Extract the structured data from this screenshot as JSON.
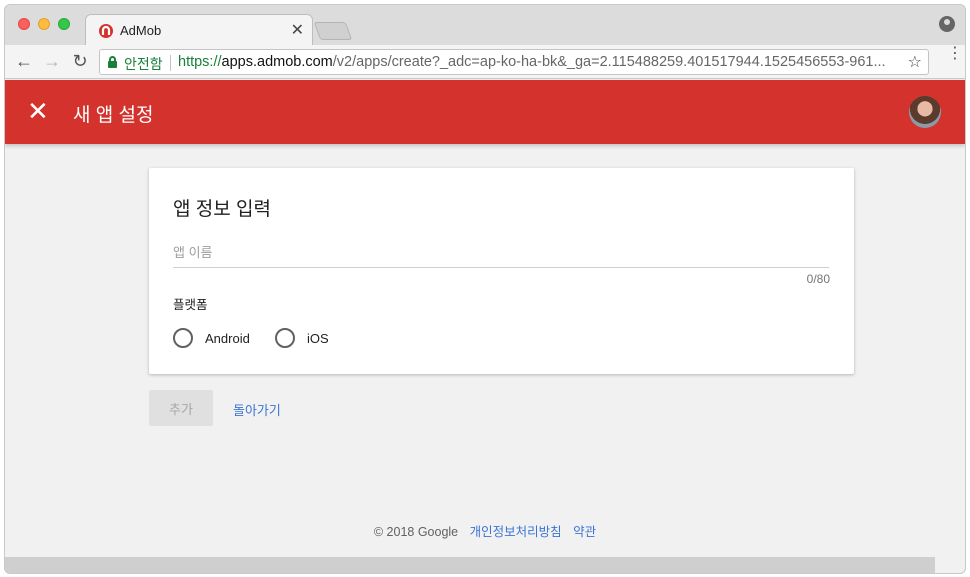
{
  "browser": {
    "tab": {
      "title": "AdMob",
      "close": "✕"
    },
    "secure_label": "안전함",
    "url": {
      "scheme": "https://",
      "host": "apps.admob.com",
      "path": "/v2/apps/create?_adc=ap-ko-ha-bk&_ga=2.115488259.401517944.1525456553-961..."
    },
    "star": "☆",
    "menu": "⋮",
    "nav": {
      "back": "←",
      "forward": "→",
      "reload": "↻"
    }
  },
  "appbar": {
    "close": "✕",
    "title": "새 앱 설정",
    "color": "#d4322c"
  },
  "card": {
    "title": "앱 정보 입력",
    "name_placeholder": "앱 이름",
    "name_value": "",
    "counter": "0/80",
    "platform_label": "플랫폼",
    "platforms": [
      {
        "label": "Android",
        "selected": false
      },
      {
        "label": "iOS",
        "selected": false
      }
    ]
  },
  "actions": {
    "add_label": "추가",
    "back_label": "돌아가기"
  },
  "footer": {
    "copyright": "© 2018 Google",
    "privacy": "개인정보처리방침",
    "terms": "약관"
  },
  "colors": {
    "accent_red": "#d4322c",
    "link_blue": "#3b74d6",
    "secure_green": "#188038"
  }
}
